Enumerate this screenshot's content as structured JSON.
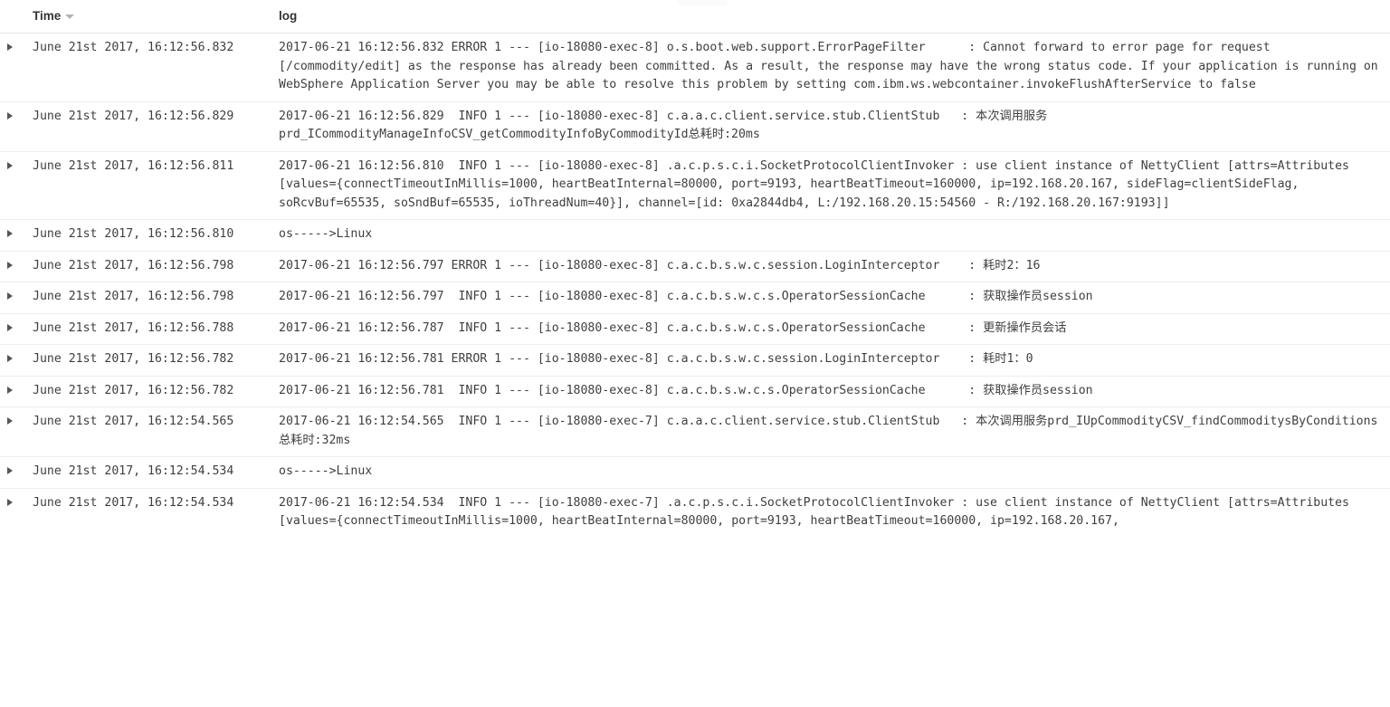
{
  "table": {
    "columns": [
      {
        "key": "toggle",
        "label": ""
      },
      {
        "key": "time",
        "label": "Time",
        "sort_icon": "caret-down-icon"
      },
      {
        "key": "log",
        "label": "log"
      }
    ],
    "header": {
      "time_label": "Time",
      "log_label": "log"
    },
    "rows": [
      {
        "toggle_icon": "caret-right-icon",
        "time": "June 21st 2017, 16:12:56.832",
        "log": "2017-06-21 16:12:56.832 ERROR 1 --- [io-18080-exec-8] o.s.boot.web.support.ErrorPageFilter      : Cannot forward to error page for request [/commodity/edit] as the response has already been committed. As a result, the response may have the wrong status code. If your application is running on WebSphere Application Server you may be able to resolve this problem by setting com.ibm.ws.webcontainer.invokeFlushAfterService to false"
      },
      {
        "toggle_icon": "caret-right-icon",
        "time": "June 21st 2017, 16:12:56.829",
        "log": "2017-06-21 16:12:56.829  INFO 1 --- [io-18080-exec-8] c.a.a.c.client.service.stub.ClientStub   : 本次调用服务prd_ICommodityManageInfoCSV_getCommodityInfoByCommodityId总耗时:20ms"
      },
      {
        "toggle_icon": "caret-right-icon",
        "time": "June 21st 2017, 16:12:56.811",
        "log": "2017-06-21 16:12:56.810  INFO 1 --- [io-18080-exec-8] .a.c.p.s.c.i.SocketProtocolClientInvoker : use client instance of NettyClient [attrs=Attributes [values={connectTimeoutInMillis=1000, heartBeatInternal=80000, port=9193, heartBeatTimeout=160000, ip=192.168.20.167, sideFlag=clientSideFlag, soRcvBuf=65535, soSndBuf=65535, ioThreadNum=40}], channel=[id: 0xa2844db4, L:/192.168.20.15:54560 - R:/192.168.20.167:9193]]"
      },
      {
        "toggle_icon": "caret-right-icon",
        "time": "June 21st 2017, 16:12:56.810",
        "log": "os----->Linux"
      },
      {
        "toggle_icon": "caret-right-icon",
        "time": "June 21st 2017, 16:12:56.798",
        "log": "2017-06-21 16:12:56.797 ERROR 1 --- [io-18080-exec-8] c.a.c.b.s.w.c.session.LoginInterceptor    : 耗时2：16"
      },
      {
        "toggle_icon": "caret-right-icon",
        "time": "June 21st 2017, 16:12:56.798",
        "log": "2017-06-21 16:12:56.797  INFO 1 --- [io-18080-exec-8] c.a.c.b.s.w.c.s.OperatorSessionCache      : 获取操作员session"
      },
      {
        "toggle_icon": "caret-right-icon",
        "time": "June 21st 2017, 16:12:56.788",
        "log": "2017-06-21 16:12:56.787  INFO 1 --- [io-18080-exec-8] c.a.c.b.s.w.c.s.OperatorSessionCache      : 更新操作员会话"
      },
      {
        "toggle_icon": "caret-right-icon",
        "time": "June 21st 2017, 16:12:56.782",
        "log": "2017-06-21 16:12:56.781 ERROR 1 --- [io-18080-exec-8] c.a.c.b.s.w.c.session.LoginInterceptor    : 耗时1：0"
      },
      {
        "toggle_icon": "caret-right-icon",
        "time": "June 21st 2017, 16:12:56.782",
        "log": "2017-06-21 16:12:56.781  INFO 1 --- [io-18080-exec-8] c.a.c.b.s.w.c.s.OperatorSessionCache      : 获取操作员session"
      },
      {
        "toggle_icon": "caret-right-icon",
        "time": "June 21st 2017, 16:12:54.565",
        "log": "2017-06-21 16:12:54.565  INFO 1 --- [io-18080-exec-7] c.a.a.c.client.service.stub.ClientStub   : 本次调用服务prd_IUpCommodityCSV_findCommoditysByConditions总耗时:32ms"
      },
      {
        "toggle_icon": "caret-right-icon",
        "time": "June 21st 2017, 16:12:54.534",
        "log": "os----->Linux"
      },
      {
        "toggle_icon": "caret-right-icon",
        "time": "June 21st 2017, 16:12:54.534",
        "log": "2017-06-21 16:12:54.534  INFO 1 --- [io-18080-exec-7] .a.c.p.s.c.i.SocketProtocolClientInvoker : use client instance of NettyClient [attrs=Attributes [values={connectTimeoutInMillis=1000, heartBeatInternal=80000, port=9193, heartBeatTimeout=160000, ip=192.168.20.167,"
      }
    ]
  }
}
